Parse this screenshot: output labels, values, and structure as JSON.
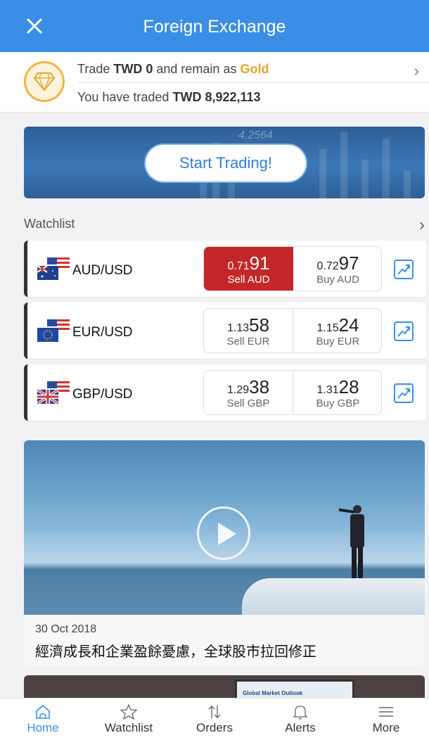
{
  "header": {
    "title": "Foreign Exchange"
  },
  "status": {
    "line1_prefix": "Trade",
    "line1_amount": "TWD 0",
    "line1_middle": "and remain as",
    "tier": "Gold",
    "line2_prefix": "You have traded",
    "line2_amount": "TWD 8,922,113"
  },
  "banner": {
    "cta": "Start Trading!",
    "bg_number": "4.2564"
  },
  "watchlist": {
    "title": "Watchlist",
    "rows": [
      {
        "pair": "AUD/USD",
        "sell_prefix": "0.71",
        "sell_big": "91",
        "sell_label": "Sell AUD",
        "buy_prefix": "0.72",
        "buy_big": "97",
        "buy_label": "Buy AUD"
      },
      {
        "pair": "EUR/USD",
        "sell_prefix": "1.13",
        "sell_big": "58",
        "sell_label": "Sell EUR",
        "buy_prefix": "1.15",
        "buy_big": "24",
        "buy_label": "Buy EUR"
      },
      {
        "pair": "GBP/USD",
        "sell_prefix": "1.29",
        "sell_big": "38",
        "sell_label": "Sell GBP",
        "buy_prefix": "1.31",
        "buy_big": "28",
        "buy_label": "Buy GBP"
      }
    ]
  },
  "video": {
    "date": "30 Oct 2018",
    "headline": "經濟成長和企業盈餘憂慮，全球股市拉回修正"
  },
  "next_card": {
    "screen_title": "Global Market Outlook"
  },
  "tabs": [
    {
      "label": "Home",
      "icon": "home-icon"
    },
    {
      "label": "Watchlist",
      "icon": "star-icon"
    },
    {
      "label": "Orders",
      "icon": "arrows-icon"
    },
    {
      "label": "Alerts",
      "icon": "bell-icon"
    },
    {
      "label": "More",
      "icon": "menu-icon"
    }
  ],
  "colors": {
    "primary": "#3a8ee6",
    "gold": "#e5a72c",
    "sell_active": "#c3272a"
  }
}
